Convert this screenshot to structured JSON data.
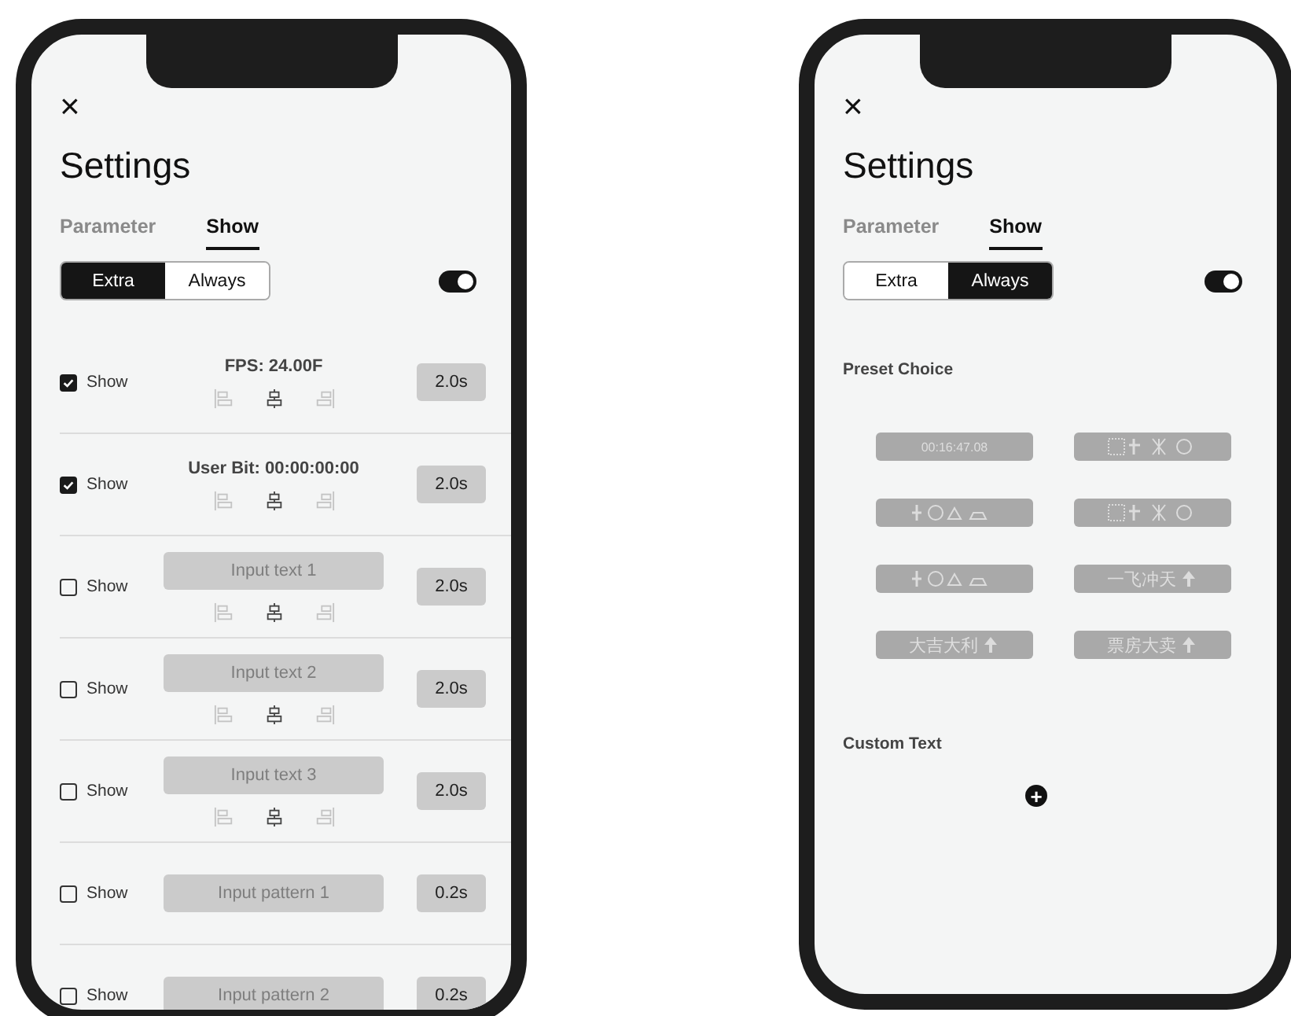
{
  "phones": [
    {
      "close": "×",
      "title": "Settings",
      "tabs": [
        {
          "label": "Parameter",
          "selected": false
        },
        {
          "label": "Show",
          "selected": true
        }
      ],
      "modes": [
        {
          "label": "Extra",
          "selected": true
        },
        {
          "label": "Always",
          "selected": false
        }
      ],
      "toggle": {
        "on": true
      },
      "rows": [
        {
          "kind": "info",
          "checked": true,
          "label": "Show",
          "text": "FPS: 24.00F",
          "alignments": [
            {
              "kind": "left",
              "selected": false
            },
            {
              "kind": "center",
              "selected": true
            },
            {
              "kind": "right",
              "selected": false
            }
          ],
          "duration": "2.0s"
        },
        {
          "kind": "info",
          "checked": true,
          "label": "Show",
          "text": "User Bit: 00:00:00:00",
          "alignments": [
            {
              "kind": "left",
              "selected": false
            },
            {
              "kind": "center",
              "selected": true
            },
            {
              "kind": "right",
              "selected": false
            }
          ],
          "duration": "2.0s"
        },
        {
          "kind": "input",
          "checked": false,
          "label": "Show",
          "placeholder": "Input text 1",
          "alignments": [
            {
              "kind": "left",
              "selected": false
            },
            {
              "kind": "center",
              "selected": true
            },
            {
              "kind": "right",
              "selected": false
            }
          ],
          "duration": "2.0s"
        },
        {
          "kind": "input",
          "checked": false,
          "label": "Show",
          "placeholder": "Input text 2",
          "alignments": [
            {
              "kind": "left",
              "selected": false
            },
            {
              "kind": "center",
              "selected": true
            },
            {
              "kind": "right",
              "selected": false
            }
          ],
          "duration": "2.0s"
        },
        {
          "kind": "input",
          "checked": false,
          "label": "Show",
          "placeholder": "Input text 3",
          "alignments": [
            {
              "kind": "left",
              "selected": false
            },
            {
              "kind": "center",
              "selected": true
            },
            {
              "kind": "right",
              "selected": false
            }
          ],
          "duration": "2.0s"
        },
        {
          "kind": "input",
          "checked": false,
          "label": "Show",
          "placeholder": "Input pattern 1",
          "duration": "0.2s"
        },
        {
          "kind": "input",
          "checked": false,
          "label": "Show",
          "placeholder": "Input pattern 2",
          "duration": "0.2s"
        }
      ]
    },
    {
      "close": "×",
      "title": "Settings",
      "tabs": [
        {
          "label": "Parameter",
          "selected": false
        },
        {
          "label": "Show",
          "selected": true
        }
      ],
      "modes": [
        {
          "label": "Extra",
          "selected": false
        },
        {
          "label": "Always",
          "selected": true
        }
      ],
      "toggle": {
        "on": true
      },
      "preset_heading": "Preset Choice",
      "presets": [
        {
          "kind": "text",
          "text": "00:16:47.08"
        },
        {
          "kind": "pictogram"
        },
        {
          "kind": "pictogram"
        },
        {
          "kind": "pictogram"
        },
        {
          "kind": "pictogram"
        },
        {
          "kind": "text_with_icon",
          "text": "一飞冲天"
        },
        {
          "kind": "text_with_icon",
          "text": "大吉大利"
        },
        {
          "kind": "text_with_icon",
          "text": "票房大卖"
        }
      ],
      "custom_heading": "Custom Text",
      "add": "+"
    }
  ]
}
